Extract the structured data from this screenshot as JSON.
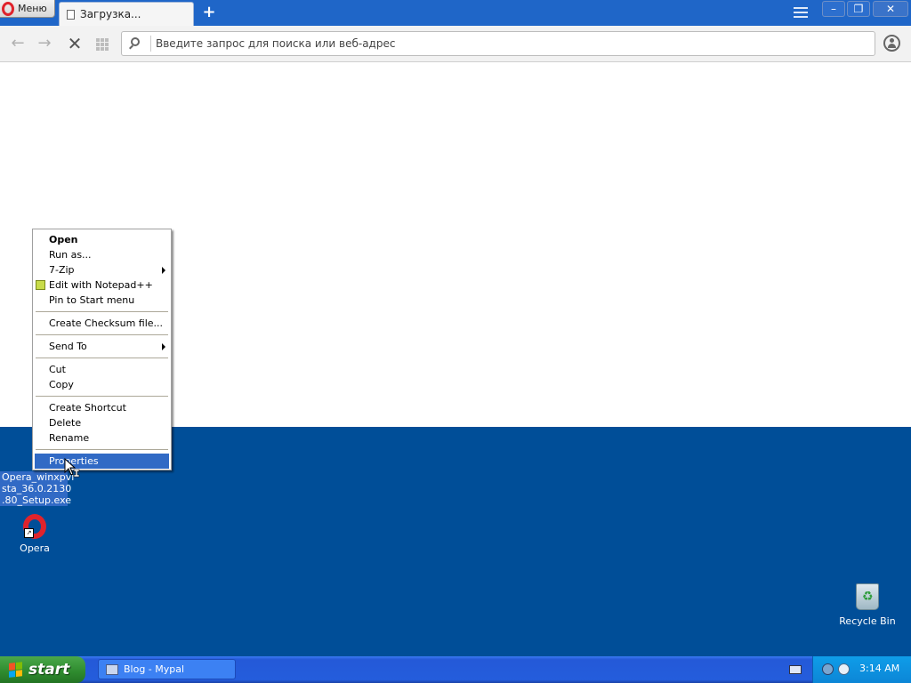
{
  "browser": {
    "menu_label": "Меню",
    "tab_title": "Загрузка...",
    "address_placeholder": "Введите запрос для поиска или веб-адрес"
  },
  "context_menu": {
    "items": [
      {
        "label": "Open",
        "bold": true
      },
      {
        "label": "Run as..."
      },
      {
        "label": "7-Zip",
        "submenu": true
      },
      {
        "label": "Edit with Notepad++",
        "icon": "notepad-plus-plus-icon"
      },
      {
        "label": "Pin to Start menu"
      },
      {
        "label": "Create Checksum file..."
      },
      {
        "label": "Send To",
        "submenu": true
      },
      {
        "label": "Cut"
      },
      {
        "label": "Copy"
      },
      {
        "label": "Create Shortcut"
      },
      {
        "label": "Delete"
      },
      {
        "label": "Rename"
      },
      {
        "label": "Properties",
        "highlighted": true
      }
    ]
  },
  "desktop": {
    "selected_file_lines": [
      "Opera_winxpvi",
      "sta_36.0.2130",
      ".80_Setup.exe"
    ],
    "opera_shortcut_label": "Opera",
    "recycle_bin_label": "Recycle Bin"
  },
  "taskbar": {
    "start_label": "start",
    "task_label": "Blog - Mypal",
    "clock": "3:14 AM"
  },
  "colors": {
    "desktop": "#004e98",
    "taskbar": "#245ddc",
    "start_button": "#2e8a2e",
    "menu_highlight": "#316ac5",
    "opera_red": "#e0232c"
  }
}
